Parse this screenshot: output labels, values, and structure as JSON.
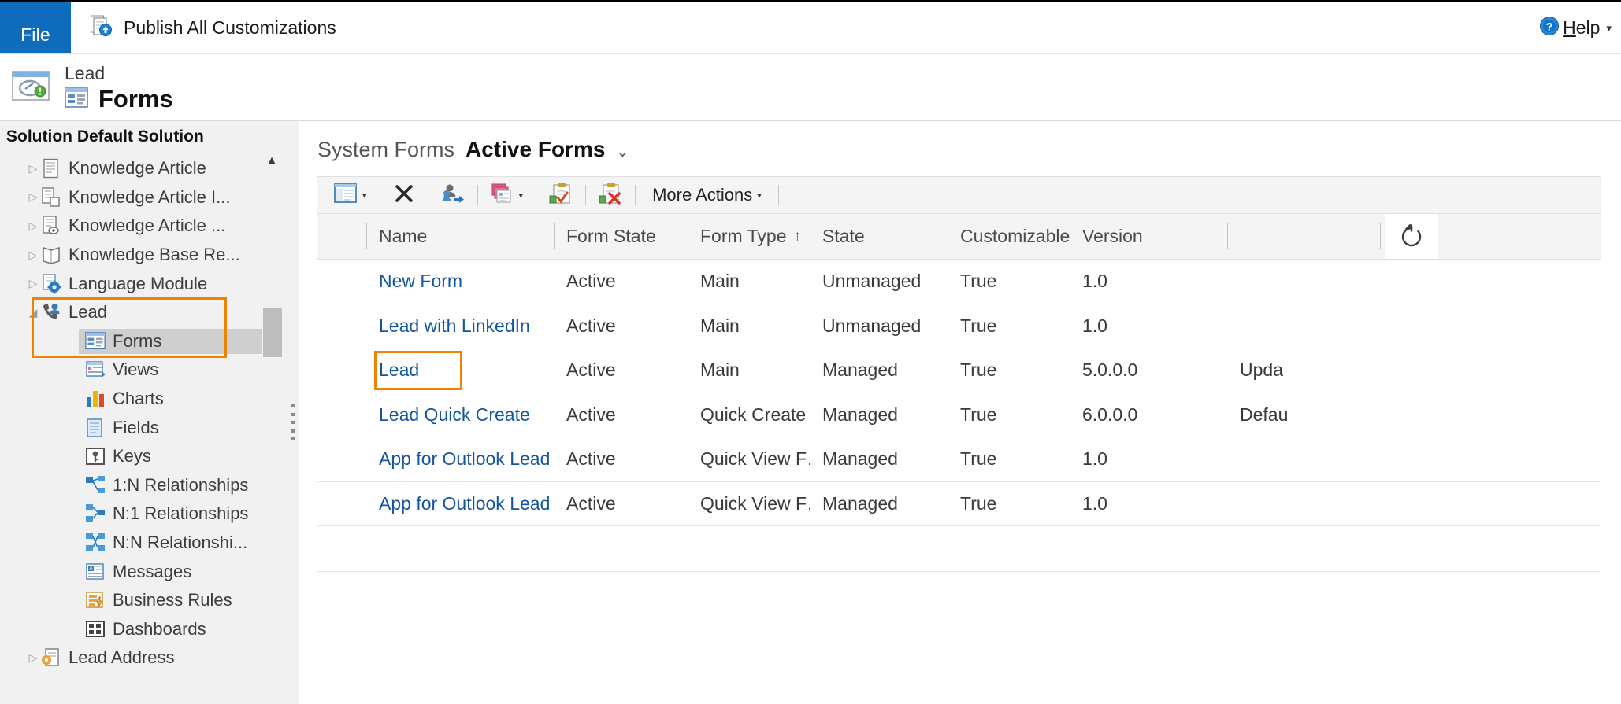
{
  "topbar": {
    "file_label": "File",
    "publish_label": "Publish All Customizations",
    "publish_icon": "publish-icon",
    "help_label": "Help",
    "help_icon": "help-question-icon",
    "help_caret": "▾"
  },
  "entity": {
    "icon": "lead-entity-icon",
    "subtitle": "Lead",
    "forms_icon": "forms-icon",
    "title": "Forms"
  },
  "sidebar": {
    "solution_label": "Solution Default Solution",
    "scroll_up_glyph": "▲",
    "items": [
      {
        "label": "Knowledge Article",
        "icon": "knowledge-article-icon",
        "level": 1,
        "expander": "▷",
        "selected": false
      },
      {
        "label": "Knowledge Article I...",
        "icon": "knowledge-article-incident-icon",
        "level": 1,
        "expander": "▷",
        "selected": false
      },
      {
        "label": "Knowledge Article ...",
        "icon": "knowledge-article-view-icon",
        "level": 1,
        "expander": "▷",
        "selected": false
      },
      {
        "label": "Knowledge Base Re...",
        "icon": "knowledge-base-record-icon",
        "level": 1,
        "expander": "▷",
        "selected": false
      },
      {
        "label": "Language Module",
        "icon": "language-module-icon",
        "level": 1,
        "expander": "▷",
        "selected": false
      },
      {
        "label": "Lead",
        "icon": "lead-icon",
        "level": 1,
        "expander": "◢",
        "selected": false
      },
      {
        "label": "Forms",
        "icon": "forms-icon",
        "level": 2,
        "expander": "",
        "selected": true
      },
      {
        "label": "Views",
        "icon": "views-icon",
        "level": 2,
        "expander": "",
        "selected": false
      },
      {
        "label": "Charts",
        "icon": "charts-icon",
        "level": 2,
        "expander": "",
        "selected": false
      },
      {
        "label": "Fields",
        "icon": "fields-icon",
        "level": 2,
        "expander": "",
        "selected": false
      },
      {
        "label": "Keys",
        "icon": "keys-icon",
        "level": 2,
        "expander": "",
        "selected": false
      },
      {
        "label": "1:N Relationships",
        "icon": "one-to-many-icon",
        "level": 2,
        "expander": "",
        "selected": false
      },
      {
        "label": "N:1 Relationships",
        "icon": "many-to-one-icon",
        "level": 2,
        "expander": "",
        "selected": false
      },
      {
        "label": "N:N Relationshi...",
        "icon": "many-to-many-icon",
        "level": 2,
        "expander": "",
        "selected": false
      },
      {
        "label": "Messages",
        "icon": "messages-icon",
        "level": 2,
        "expander": "",
        "selected": false
      },
      {
        "label": "Business Rules",
        "icon": "business-rules-icon",
        "level": 2,
        "expander": "",
        "selected": false
      },
      {
        "label": "Dashboards",
        "icon": "dashboards-icon",
        "level": 2,
        "expander": "",
        "selected": false
      },
      {
        "label": "Lead Address",
        "icon": "lead-address-icon",
        "level": 1,
        "expander": "▷",
        "selected": false
      }
    ]
  },
  "main": {
    "view_scope": "System Forms",
    "view_name": "Active Forms",
    "view_caret": "⌄",
    "toolbar": {
      "new_icon": "new-form-icon",
      "delete_icon": "delete-x-icon",
      "security_roles_icon": "assign-security-roles-icon",
      "form_order_icon": "form-order-icon",
      "publish_icon": "publish-form-icon",
      "unpublish_icon": "remove-from-solution-icon",
      "more_actions_label": "More Actions",
      "caret": "▾"
    },
    "grid": {
      "refresh_icon": "refresh-icon",
      "columns": [
        {
          "label": "Name",
          "sort": ""
        },
        {
          "label": "Form State",
          "sort": ""
        },
        {
          "label": "Form Type",
          "sort": "↑"
        },
        {
          "label": "State",
          "sort": ""
        },
        {
          "label": "Customizable",
          "sort": ""
        },
        {
          "label": "Version",
          "sort": ""
        }
      ],
      "rows": [
        {
          "name": "New Form",
          "form_state": "Active",
          "form_type": "Main",
          "state": "Unmanaged",
          "customizable": "True",
          "version": "1.0",
          "last": "",
          "highlight": false
        },
        {
          "name": "Lead with LinkedIn",
          "form_state": "Active",
          "form_type": "Main",
          "state": "Unmanaged",
          "customizable": "True",
          "version": "1.0",
          "last": "",
          "highlight": false
        },
        {
          "name": "Lead",
          "form_state": "Active",
          "form_type": "Main",
          "state": "Managed",
          "customizable": "True",
          "version": "5.0.0.0",
          "last": "Upda",
          "highlight": true
        },
        {
          "name": "Lead Quick Create",
          "form_state": "Active",
          "form_type": "Quick Create",
          "state": "Managed",
          "customizable": "True",
          "version": "6.0.0.0",
          "last": "Defau",
          "highlight": false
        },
        {
          "name": "App for Outlook Lead Card",
          "form_state": "Active",
          "form_type": "Quick View F…",
          "state": "Managed",
          "customizable": "True",
          "version": "1.0",
          "last": "",
          "highlight": false
        },
        {
          "name": "App for Outlook Lead Quick Vi…",
          "form_state": "Active",
          "form_type": "Quick View F…",
          "state": "Managed",
          "customizable": "True",
          "version": "1.0",
          "last": "",
          "highlight": false
        }
      ]
    }
  },
  "colors": {
    "accent_blue": "#0f6cbd",
    "link_blue": "#15569e",
    "highlight_orange": "#ef8200",
    "sidebar_bg": "#f1f1f1",
    "toolbar_bg": "#f4f4f4"
  }
}
